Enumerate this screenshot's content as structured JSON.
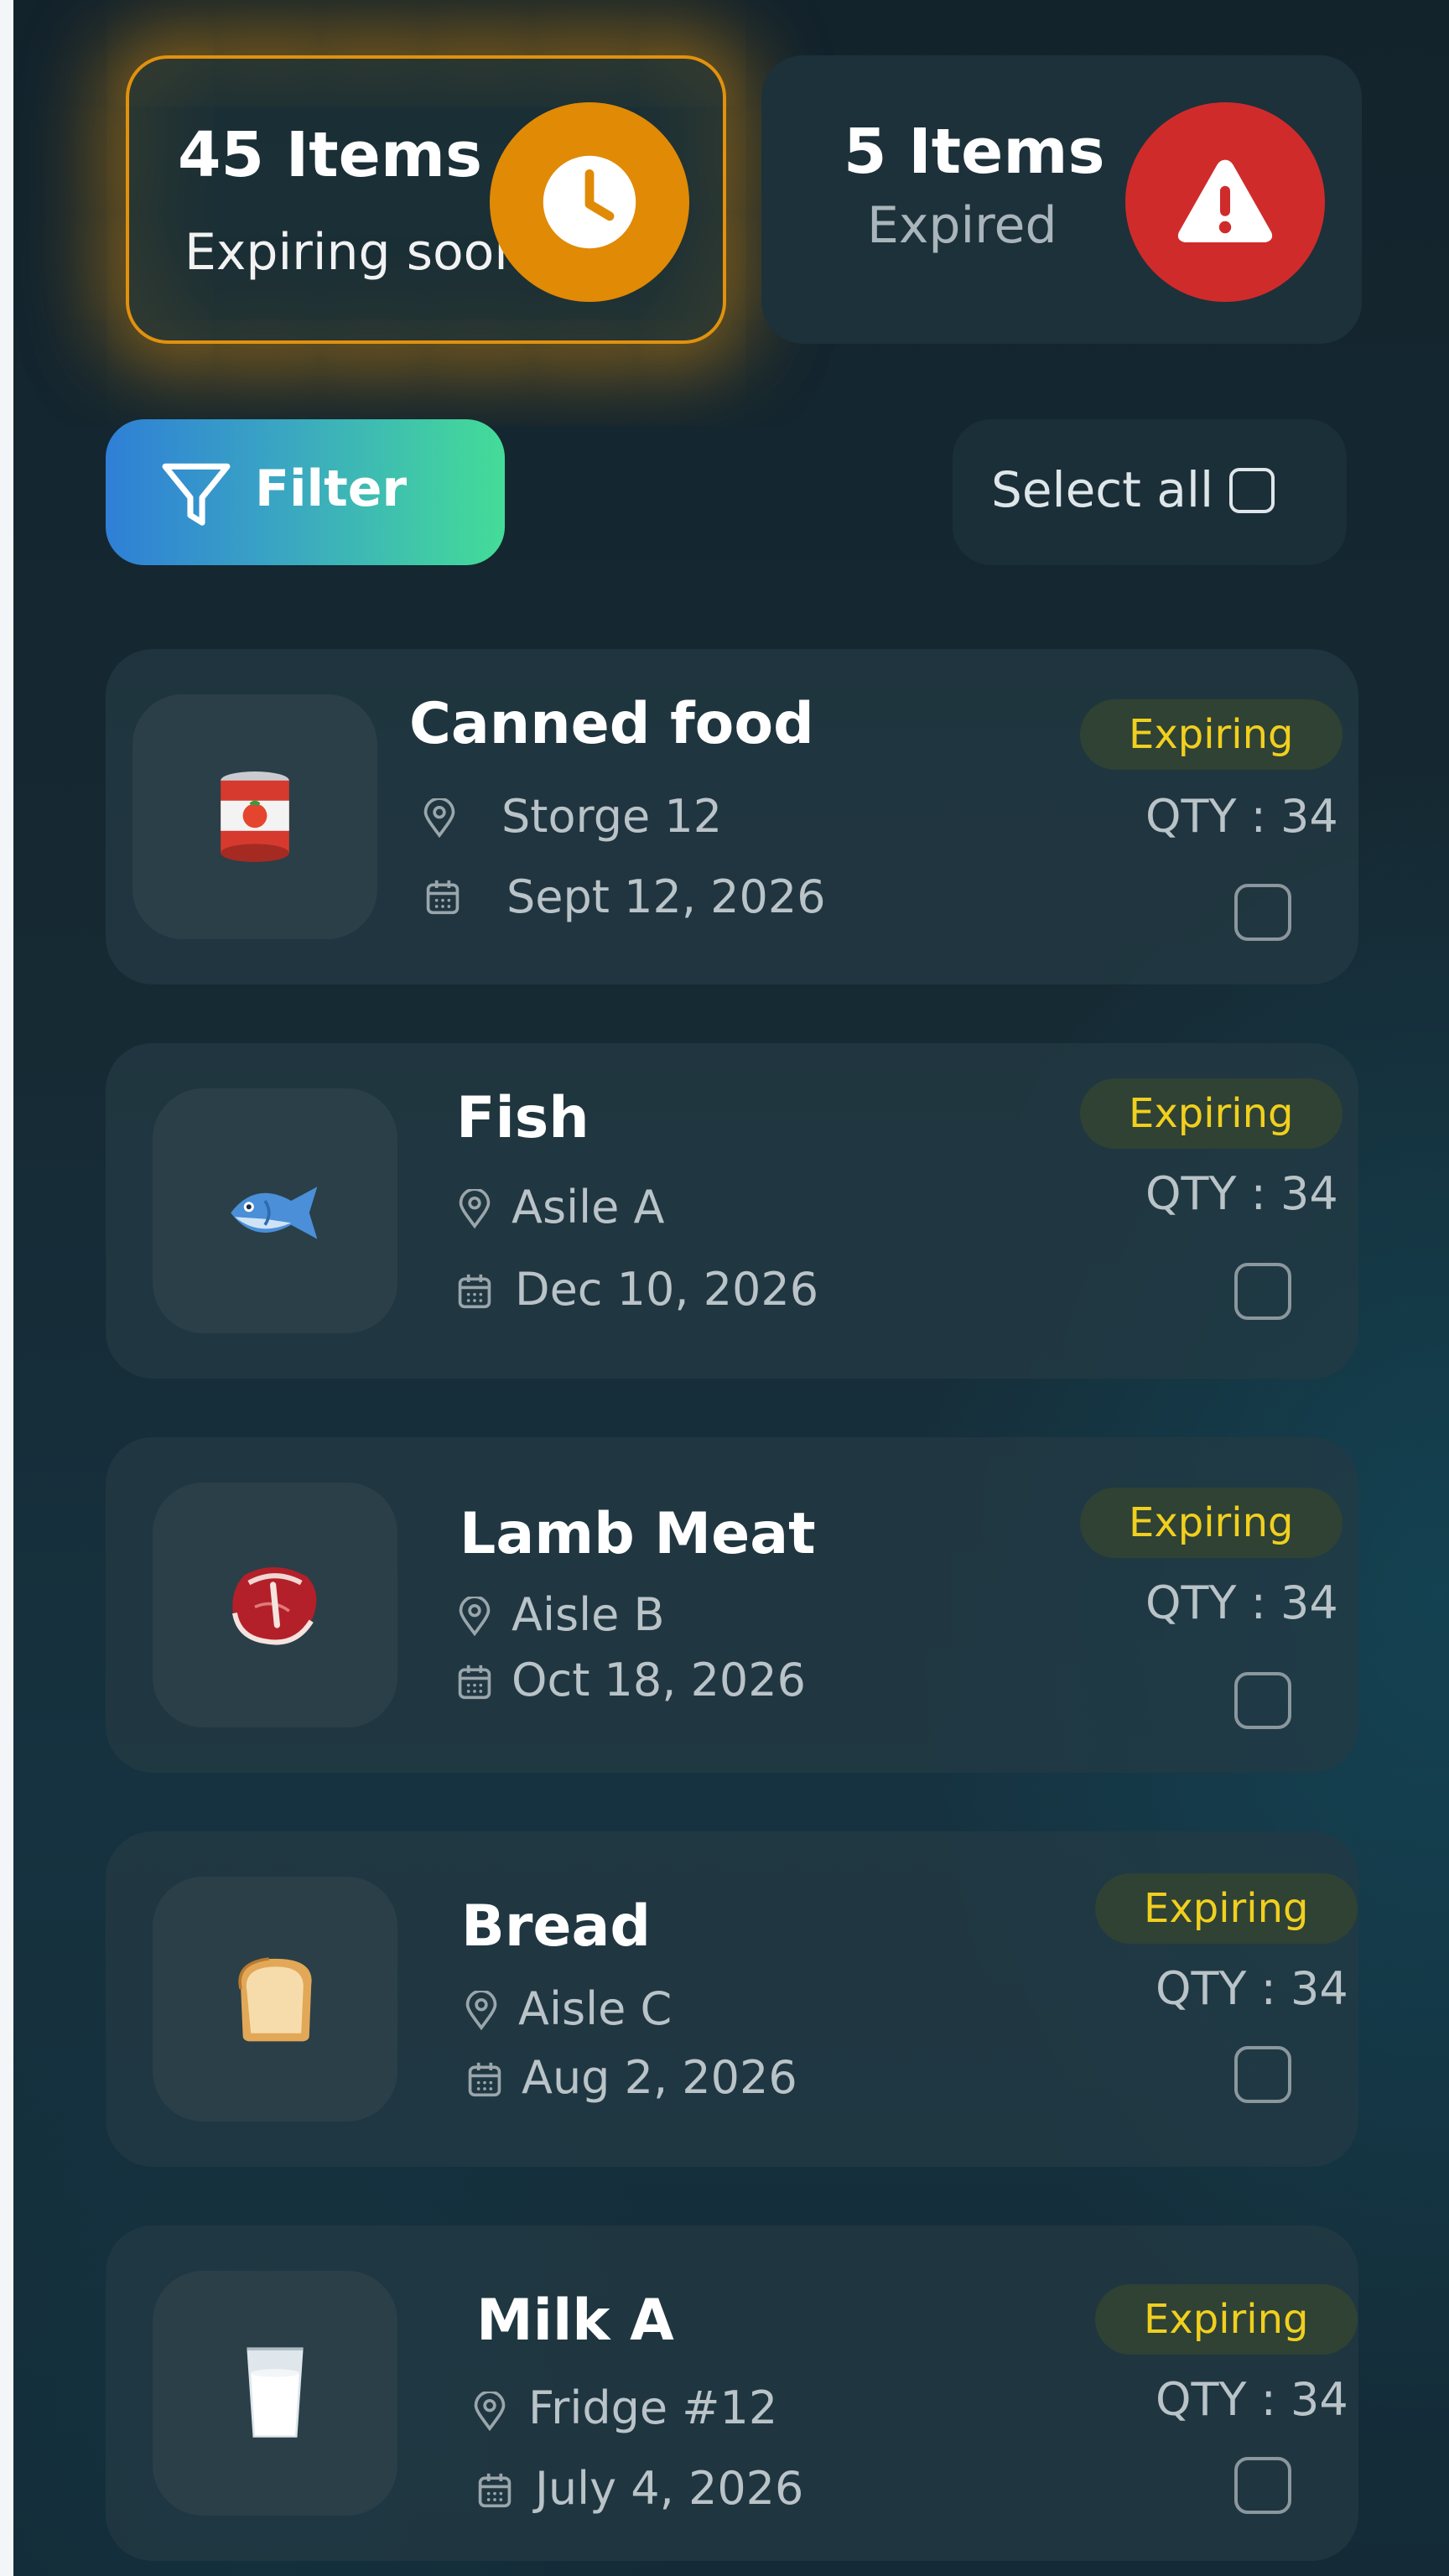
{
  "summary": {
    "expiring": {
      "count": "45 Items",
      "label": "Expiring soon",
      "icon": "clock-icon",
      "color": "#e08a06"
    },
    "expired": {
      "count": "5 Items",
      "label": "Expired",
      "icon": "warning-icon",
      "color": "#d02b2b"
    }
  },
  "toolbar": {
    "filter_label": "Filter",
    "select_all_label": "Select all"
  },
  "items": [
    {
      "name": "Canned food",
      "location": "Storge  12",
      "date": "Sept 12, 2026",
      "status": "Expiring",
      "qty": "QTY : 34",
      "image": "canned-food-icon"
    },
    {
      "name": "Fish",
      "location": "Asile A",
      "date": "Dec 10, 2026",
      "status": "Expiring",
      "qty": "QTY : 34",
      "image": "fish-icon"
    },
    {
      "name": "Lamb Meat",
      "location": "Aisle B",
      "date": "Oct 18, 2026",
      "status": "Expiring",
      "qty": "QTY : 34",
      "image": "meat-icon"
    },
    {
      "name": "Bread",
      "location": "Aisle C",
      "date": "Aug 2, 2026",
      "status": "Expiring",
      "qty": "QTY : 34",
      "image": "bread-icon"
    },
    {
      "name": "Milk A",
      "location": "Fridge #12",
      "date": "July  4, 2026",
      "status": "Expiring",
      "qty": "QTY : 34",
      "image": "milk-icon"
    }
  ],
  "colors": {
    "status_expiring": "#f1cf1e",
    "accent_filter_start": "#2f7fd6",
    "accent_filter_end": "#44dc98"
  }
}
